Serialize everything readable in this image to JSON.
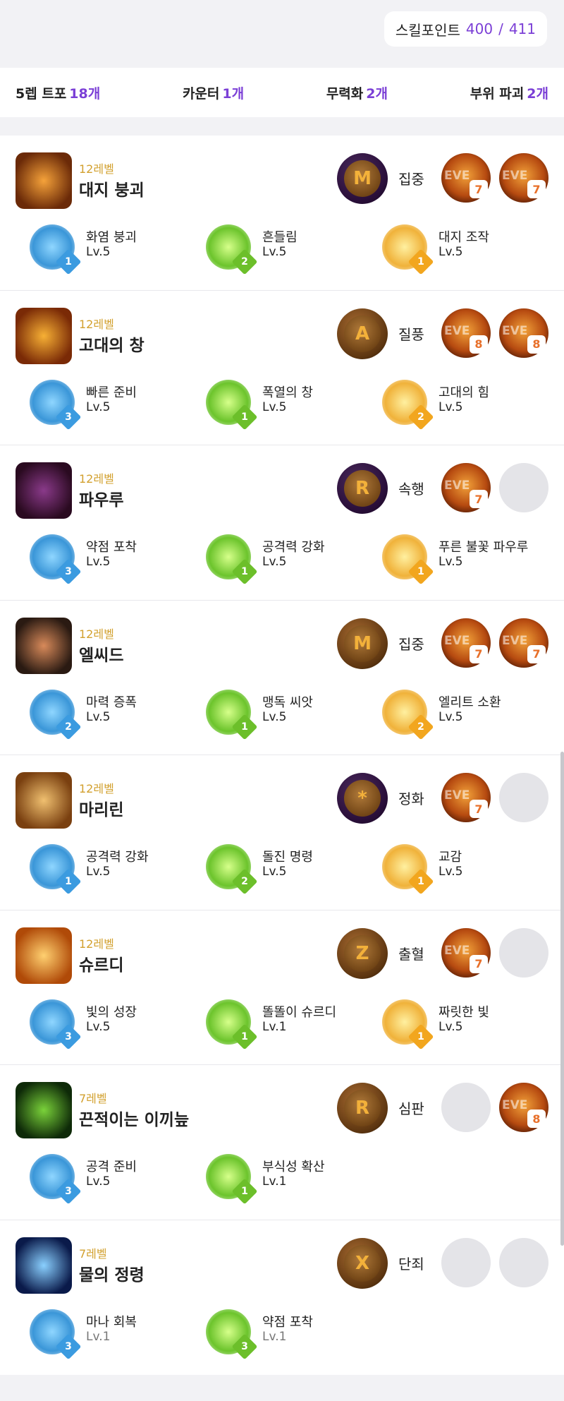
{
  "skill_points": {
    "label": "스킬포인트",
    "used": "400",
    "total": "411"
  },
  "stats": [
    {
      "label": "5렙 트포",
      "value": "18개"
    },
    {
      "label": "카운터",
      "value": "1개"
    },
    {
      "label": "무력화",
      "value": "2개"
    },
    {
      "label": "부위 파괴",
      "value": "2개"
    }
  ],
  "skills": [
    {
      "level": "12레벨",
      "name": "대지 붕괴",
      "icon": "fire-ring-skill-icon",
      "icon_colors": [
        "#f5a23a",
        "#6b2a08"
      ],
      "rune": {
        "name": "집중",
        "color": "purple",
        "glyph": "M"
      },
      "gems": [
        {
          "text": "EVE",
          "level": "7"
        },
        {
          "text": "EVE",
          "level": "7"
        }
      ],
      "tripods": [
        {
          "name": "화염 붕괴",
          "level": "Lv.5",
          "tier": "1",
          "color": "blue",
          "icon": "blue-flame-icon"
        },
        {
          "name": "흔들림",
          "level": "Lv.5",
          "tier": "2",
          "color": "green",
          "icon": "green-burst-icon"
        },
        {
          "name": "대지 조작",
          "level": "Lv.5",
          "tier": "1",
          "color": "gold",
          "icon": "gold-comet-icon"
        }
      ]
    },
    {
      "level": "12레벨",
      "name": "고대의 창",
      "icon": "ancient-spear-skill-icon",
      "icon_colors": [
        "#f7b035",
        "#7a2a06"
      ],
      "rune": {
        "name": "질풍",
        "color": "brown",
        "glyph": "A"
      },
      "gems": [
        {
          "text": "EVE",
          "level": "8"
        },
        {
          "text": "EVE",
          "level": "8"
        }
      ],
      "tripods": [
        {
          "name": "빠른 준비",
          "level": "Lv.5",
          "tier": "3",
          "color": "blue",
          "icon": "hourglass-icon"
        },
        {
          "name": "폭열의 창",
          "level": "Lv.5",
          "tier": "1",
          "color": "green",
          "icon": "green-flame-icon"
        },
        {
          "name": "고대의 힘",
          "level": "Lv.5",
          "tier": "2",
          "color": "gold",
          "icon": "gold-arrow-up-icon"
        }
      ]
    },
    {
      "level": "12레벨",
      "name": "파우루",
      "icon": "paulu-skill-icon",
      "icon_colors": [
        "#8a3a8a",
        "#2a0a20"
      ],
      "rune": {
        "name": "속행",
        "color": "purple",
        "glyph": "R"
      },
      "gems": [
        {
          "text": "EVE",
          "level": "7"
        },
        null
      ],
      "tripods": [
        {
          "name": "약점 포착",
          "level": "Lv.5",
          "tier": "3",
          "color": "blue",
          "icon": "blue-skull-icon"
        },
        {
          "name": "공격력 강화",
          "level": "Lv.5",
          "tier": "1",
          "color": "green",
          "icon": "green-swords-icon"
        },
        {
          "name": "푸른 불꽃 파우루",
          "level": "Lv.5",
          "tier": "1",
          "color": "gold",
          "icon": "gold-phoenix-icon"
        }
      ]
    },
    {
      "level": "12레벨",
      "name": "엘씨드",
      "icon": "elcid-skill-icon",
      "icon_colors": [
        "#d88a5a",
        "#2a1a12"
      ],
      "rune": {
        "name": "집중",
        "color": "brown",
        "glyph": "M"
      },
      "gems": [
        {
          "text": "EVE",
          "level": "7"
        },
        {
          "text": "EVE",
          "level": "7"
        }
      ],
      "tripods": [
        {
          "name": "마력 증폭",
          "level": "Lv.5",
          "tier": "2",
          "color": "blue",
          "icon": "blue-swords-icon"
        },
        {
          "name": "맹독 씨앗",
          "level": "Lv.5",
          "tier": "1",
          "color": "green",
          "icon": "green-poison-icon"
        },
        {
          "name": "엘리트 소환",
          "level": "Lv.5",
          "tier": "2",
          "color": "gold",
          "icon": "gold-phoenix-icon"
        }
      ]
    },
    {
      "level": "12레벨",
      "name": "마리린",
      "icon": "marilyn-skill-icon",
      "icon_colors": [
        "#f0c070",
        "#7a4010"
      ],
      "rune": {
        "name": "정화",
        "color": "purple",
        "glyph": "*"
      },
      "gems": [
        {
          "text": "EVE",
          "level": "7"
        },
        null
      ],
      "tripods": [
        {
          "name": "공격력 강화",
          "level": "Lv.5",
          "tier": "1",
          "color": "blue",
          "icon": "blue-swords-icon"
        },
        {
          "name": "돌진 명령",
          "level": "Lv.5",
          "tier": "2",
          "color": "green",
          "icon": "green-zzz-icon"
        },
        {
          "name": "교감",
          "level": "Lv.5",
          "tier": "1",
          "color": "gold",
          "icon": "gold-compass-icon"
        }
      ]
    },
    {
      "level": "12레벨",
      "name": "슈르디",
      "icon": "shurdi-skill-icon",
      "icon_colors": [
        "#ffd070",
        "#b04a08"
      ],
      "rune": {
        "name": "출혈",
        "color": "brown",
        "glyph": "Z"
      },
      "gems": [
        {
          "text": "EVE",
          "level": "7"
        },
        null
      ],
      "tripods": [
        {
          "name": "빛의 성장",
          "level": "Lv.5",
          "tier": "3",
          "color": "blue",
          "icon": "blue-swords-icon"
        },
        {
          "name": "똘똘이 슈르디",
          "level": "Lv.1",
          "tier": "1",
          "color": "green",
          "icon": "green-staff-icon"
        },
        {
          "name": "짜릿한 빛",
          "level": "Lv.5",
          "tier": "1",
          "color": "gold",
          "icon": "gold-burst-icon"
        }
      ]
    },
    {
      "level": "7레벨",
      "name": "끈적이는 이끼늪",
      "icon": "moss-swamp-skill-icon",
      "icon_colors": [
        "#7ad23a",
        "#0e2a08"
      ],
      "rune": {
        "name": "심판",
        "color": "brown",
        "glyph": "R"
      },
      "gems": [
        null,
        {
          "text": "EVE",
          "level": "8"
        }
      ],
      "tripods": [
        {
          "name": "공격 준비",
          "level": "Lv.5",
          "tier": "3",
          "color": "blue",
          "icon": "blue-swords-icon"
        },
        {
          "name": "부식성 확산",
          "level": "Lv.1",
          "tier": "1",
          "color": "green",
          "icon": "green-spread-icon"
        }
      ]
    },
    {
      "level": "7레벨",
      "name": "물의 정령",
      "icon": "water-spirit-skill-icon",
      "icon_colors": [
        "#8ad0ff",
        "#0a1a4a"
      ],
      "rune": {
        "name": "단죄",
        "color": "brown",
        "glyph": "X"
      },
      "gems": [
        null,
        null
      ],
      "tripods": [
        {
          "name": "마나 회복",
          "level": "Lv.1",
          "tier": "3",
          "color": "blue",
          "icon": "blue-potion-icon",
          "dim": true
        },
        {
          "name": "약점 포착",
          "level": "Lv.1",
          "tier": "3",
          "color": "green",
          "icon": "green-skull-icon",
          "dim": true
        }
      ]
    }
  ]
}
